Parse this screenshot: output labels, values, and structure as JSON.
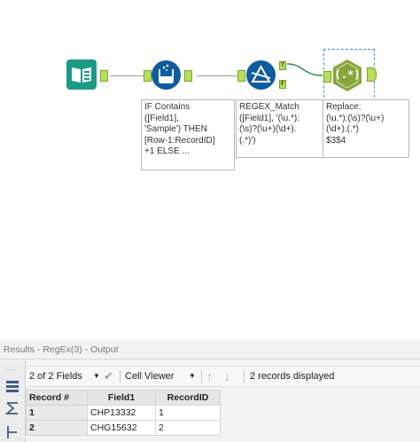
{
  "workflow": {
    "annotations": {
      "formula": "IF Contains\n([Field1],\n'Sample') THEN\n[Row-1:RecordID]\n+1 ELSE ...",
      "regex_match": "REGEX_Match\n([Field1], '(\\u.*):\n(\\s)?(\\u+)(\\d+).\n(.*)')",
      "regex_replace": "Replace:\n(\\u.*):(\\s)?(\\u+)\n(\\d+).(.*)\n$3$4"
    },
    "filter_anchors": {
      "true": "T",
      "false": "F"
    },
    "regex_symbol": "(.*)",
    "colors": {
      "input": "#1b9a86",
      "formula": "#0f5c9f",
      "filter": "#0f5c9f",
      "regex": "#86a63c",
      "anchor": "#b9df5b"
    }
  },
  "results": {
    "title": "Results - RegEx(3) - Output",
    "toolbar": {
      "fields_select": "2 of 2 Fields",
      "viewer_select": "Cell Viewer",
      "records_count": "2 records displayed"
    },
    "table": {
      "columns": [
        "Record #",
        "Field1",
        "RecordID"
      ],
      "rows": [
        {
          "record": "1",
          "field1": "CHP13332",
          "recordid": "1"
        },
        {
          "record": "2",
          "field1": "CHG15632",
          "recordid": "2"
        }
      ]
    }
  }
}
